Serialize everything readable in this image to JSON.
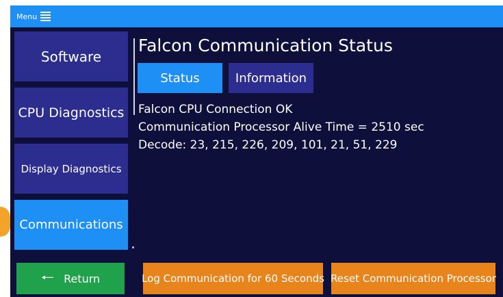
{
  "topbar": {
    "menu_label": "Menu",
    "menu_icon": "hamburger-menu-icon"
  },
  "sidebar": {
    "items": [
      {
        "label": "Software"
      },
      {
        "label": "CPU Diagnostics"
      },
      {
        "label": "Display Diagnostics"
      },
      {
        "label": "Communications",
        "active": true
      }
    ]
  },
  "main": {
    "title": "Falcon Communication Status",
    "tabs": [
      {
        "label": "Status",
        "active": true
      },
      {
        "label": "Information"
      }
    ],
    "status_lines": [
      "Falcon CPU Connection OK",
      "Communication Processor Alive Time = 2510 sec",
      "Decode: 23, 215, 226, 209, 101, 21, 51, 229"
    ]
  },
  "footer": {
    "return_label": "Return",
    "return_icon": "arrow-left-icon",
    "log_label": "Log Communication for 60 Seconds",
    "reset_label": "Reset Communication Processor"
  },
  "colors": {
    "background": "#0e0f3b",
    "topbar": "#1e90f5",
    "active": "#1e90f5",
    "inactive": "#2d2d8f",
    "return": "#20a24d",
    "action": "#e8841c",
    "marker": "#f4a32a"
  }
}
